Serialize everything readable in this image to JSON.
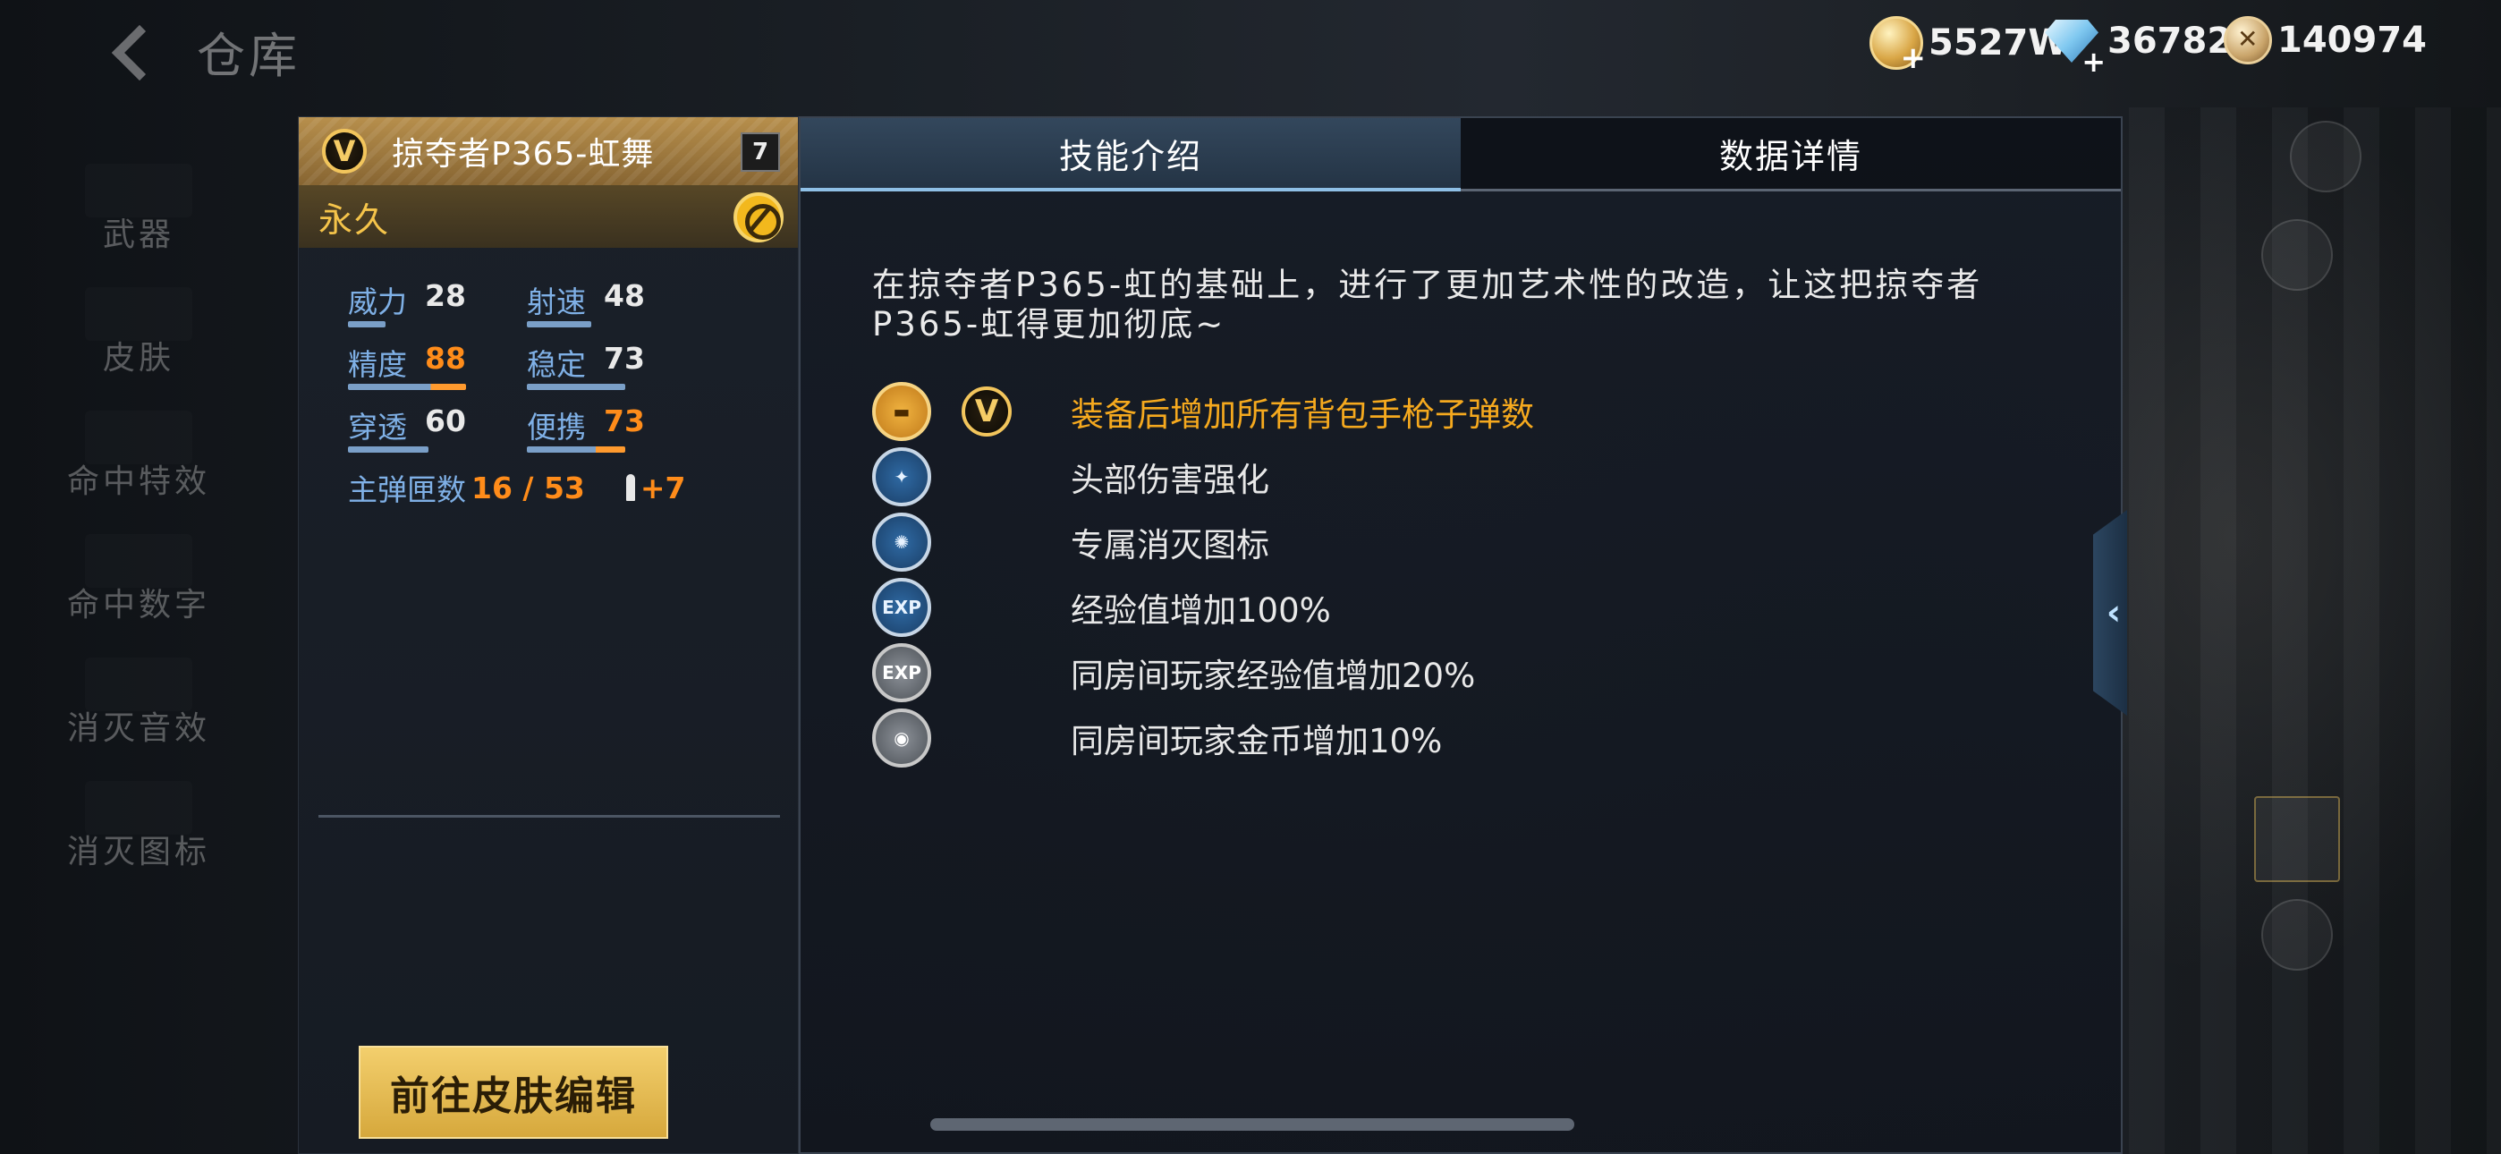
{
  "header": {
    "back_label": "仓库",
    "currency": [
      {
        "icon": "gold-coin-icon",
        "value": "5527W"
      },
      {
        "icon": "diamond-icon",
        "value": "36782"
      },
      {
        "icon": "medal-icon",
        "value": "140974"
      }
    ]
  },
  "sidebar": {
    "items": [
      {
        "label": "武器"
      },
      {
        "label": "皮肤"
      },
      {
        "label": "命中特效"
      },
      {
        "label": "命中数字"
      },
      {
        "label": "消灭音效"
      },
      {
        "label": "消灭图标"
      }
    ]
  },
  "weapon": {
    "name": "掠夺者P365-虹舞",
    "level": "7",
    "badge": "V",
    "duration": "永久",
    "stats": [
      {
        "label": "威力",
        "value": "28",
        "highlight": false,
        "fill": 0.28
      },
      {
        "label": "射速",
        "value": "48",
        "highlight": false,
        "fill": 0.48
      },
      {
        "label": "精度",
        "value": "88",
        "highlight": true,
        "fill": 0.88
      },
      {
        "label": "稳定",
        "value": "73",
        "highlight": false,
        "fill": 0.73
      },
      {
        "label": "穿透",
        "value": "60",
        "highlight": false,
        "fill": 0.6
      },
      {
        "label": "便携",
        "value": "73",
        "highlight": true,
        "fill": 0.73
      }
    ],
    "ammo_label": "主弹匣数",
    "ammo_value": "16 / 53",
    "ammo_bonus": "+7",
    "edit_button": "前往皮肤编辑"
  },
  "tabs": [
    {
      "label": "技能介绍",
      "active": true
    },
    {
      "label": "数据详情",
      "active": false
    }
  ],
  "skill_panel": {
    "description": "在掠夺者P365-虹的基础上，进行了更加艺术性的改造，让这把掠夺者P365-虹得更加彻底~",
    "skills": [
      {
        "text": "装备后增加所有背包手枪子弹数",
        "icon": "pistol-icon",
        "color": "gold",
        "badge": "V"
      },
      {
        "text": "头部伤害强化",
        "icon": "headshot-icon",
        "color": "blue"
      },
      {
        "text": "专属消灭图标",
        "icon": "kill-icon-icon",
        "color": "blue"
      },
      {
        "text": "经验值增加100%",
        "icon": "exp-icon",
        "color": "blue",
        "glyph": "EXP"
      },
      {
        "text": "同房间玩家经验值增加20%",
        "icon": "room-exp-icon",
        "color": "gray",
        "glyph": "EXP"
      },
      {
        "text": "同房间玩家金币增加10%",
        "icon": "room-coin-icon",
        "color": "gray"
      }
    ]
  }
}
